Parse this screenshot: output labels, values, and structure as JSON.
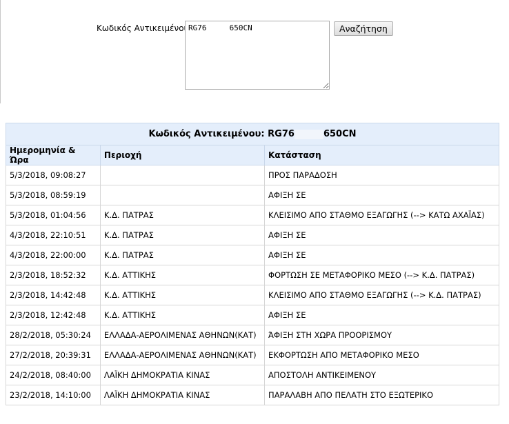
{
  "search": {
    "label": "Κωδικός Αντικειμένου:",
    "value": "RG76     650CN",
    "button_label": "Αναζήτηση"
  },
  "results": {
    "caption_prefix": "Κωδικός Αντικειμένου: RG76",
    "caption_suffix": "650CN",
    "headers": {
      "date": "Ημερομηνία & Ώρα",
      "area": "Περιοχή",
      "status": "Κατάσταση"
    },
    "rows": [
      {
        "date": "5/3/2018, 09:08:27",
        "area": "",
        "status": "ΠΡΟΣ ΠΑΡΑΔΟΣΗ"
      },
      {
        "date": "5/3/2018, 08:59:19",
        "area": "",
        "status": "ΑΦΙΞΗ ΣΕ"
      },
      {
        "date": "5/3/2018, 01:04:56",
        "area": "Κ.Δ. ΠΑΤΡΑΣ",
        "status": "ΚΛΕΙΣΙΜΟ ΑΠΟ ΣΤΑΘΜΟ ΕΞΑΓΩΓΗΣ (--> ΚΑΤΩ ΑΧΑΪΑΣ)"
      },
      {
        "date": "4/3/2018, 22:10:51",
        "area": "Κ.Δ. ΠΑΤΡΑΣ",
        "status": "ΑΦΙΞΗ ΣΕ"
      },
      {
        "date": "4/3/2018, 22:00:00",
        "area": "Κ.Δ. ΠΑΤΡΑΣ",
        "status": "ΑΦΙΞΗ ΣΕ"
      },
      {
        "date": "2/3/2018, 18:52:32",
        "area": "Κ.Δ. ΑΤΤΙΚΗΣ",
        "status": "ΦΟΡΤΩΣΗ ΣΕ ΜΕΤΑΦΟΡΙΚΟ ΜΕΣΟ (--> Κ.Δ. ΠΑΤΡΑΣ)"
      },
      {
        "date": "2/3/2018, 14:42:48",
        "area": "Κ.Δ. ΑΤΤΙΚΗΣ",
        "status": "ΚΛΕΙΣΙΜΟ ΑΠΟ ΣΤΑΘΜΟ ΕΞΑΓΩΓΗΣ (--> Κ.Δ. ΠΑΤΡΑΣ)"
      },
      {
        "date": "2/3/2018, 12:42:48",
        "area": "Κ.Δ. ΑΤΤΙΚΗΣ",
        "status": "ΑΦΙΞΗ ΣΕ"
      },
      {
        "date": "28/2/2018, 05:30:24",
        "area": "ΕΛΛΑΔΑ-ΑΕΡΟΛΙΜΕΝΑΣ ΑΘΗΝΩΝ(ΚΑΤ)",
        "status": "ΆΦΙΞΗ ΣΤΗ ΧΩΡΑ ΠΡΟΟΡΙΣΜΟΥ"
      },
      {
        "date": "27/2/2018, 20:39:31",
        "area": "ΕΛΛΑΔΑ-ΑΕΡΟΛΙΜΕΝΑΣ ΑΘΗΝΩΝ(ΚΑΤ)",
        "status": "ΕΚΦΟΡΤΩΣΗ ΑΠΟ ΜΕΤΑΦΟΡΙΚΟ ΜΕΣΟ"
      },
      {
        "date": "24/2/2018, 08:40:00",
        "area": "ΛΑΪΚΗ ΔΗΜΟΚΡΑΤΙΑ ΚΙΝΑΣ",
        "status": "ΑΠΟΣΤΟΛΗ ΑΝΤΙΚΕΙΜΕΝΟΥ"
      },
      {
        "date": "23/2/2018, 14:10:00",
        "area": "ΛΑΪΚΗ ΔΗΜΟΚΡΑΤΙΑ ΚΙΝΑΣ",
        "status": "ΠΑΡΑΛΑΒΗ ΑΠΟ ΠΕΛΑΤΗ ΣΤΟ ΕΞΩΤΕΡΙΚΟ"
      }
    ]
  }
}
